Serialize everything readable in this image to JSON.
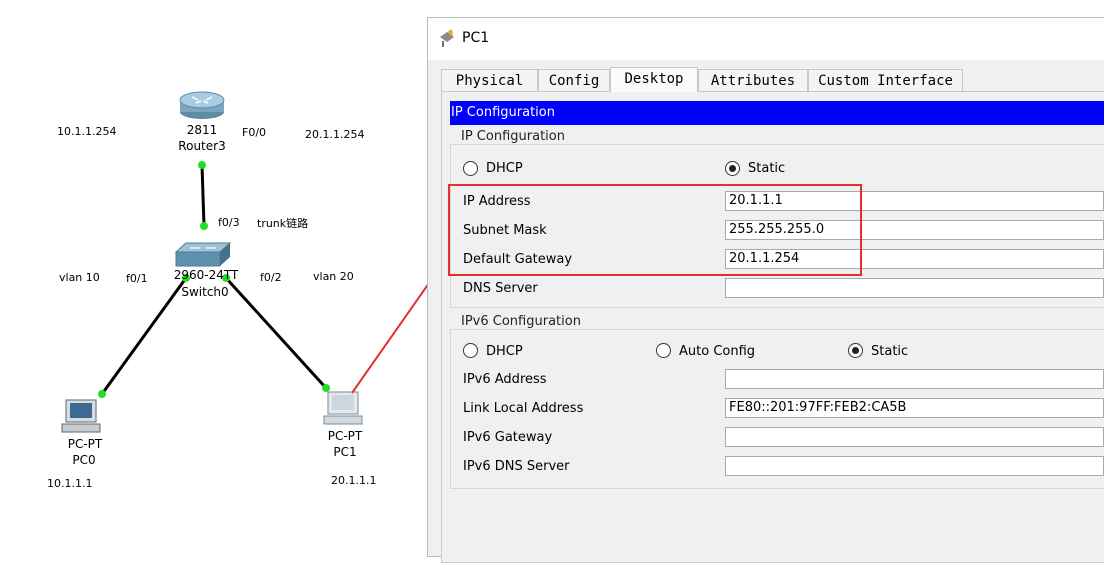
{
  "topology": {
    "router": {
      "model": "2811",
      "name": "Router3"
    },
    "switch": {
      "model": "2960-24TT",
      "name": "Switch0"
    },
    "pc0": {
      "model": "PC-PT",
      "name": "PC0",
      "ip": "10.1.1.1"
    },
    "pc1": {
      "model": "PC-PT",
      "name": "PC1",
      "ip": "20.1.1.1"
    },
    "labels": {
      "left_gw": "10.1.1.254",
      "router_port": "F0/0",
      "right_gw": "20.1.1.254",
      "switch_trunk_port": "f0/3",
      "trunk": "trunk链路",
      "vlan_left": "vlan 10",
      "port_left": "f0/1",
      "port_right": "f0/2",
      "vlan_right": "vlan 20"
    },
    "colors": {
      "link": "#000000",
      "port_dot": "#22dd22",
      "annotation_arrow": "#e03030"
    }
  },
  "window": {
    "title": "PC1",
    "icon": "packet-tracer-icon",
    "tabs": [
      {
        "label": "Physical",
        "active": false
      },
      {
        "label": "Config",
        "active": false
      },
      {
        "label": "Desktop",
        "active": true
      },
      {
        "label": "Attributes",
        "active": false
      },
      {
        "label": "Custom Interface",
        "active": false
      }
    ],
    "header": "IP Configuration",
    "ipv4": {
      "group_title": "IP Configuration",
      "mode_options": [
        {
          "label": "DHCP",
          "selected": false
        },
        {
          "label": "Static",
          "selected": true
        }
      ],
      "fields": [
        {
          "label": "IP Address",
          "value": "20.1.1.1"
        },
        {
          "label": "Subnet Mask",
          "value": "255.255.255.0"
        },
        {
          "label": "Default Gateway",
          "value": "20.1.1.254"
        },
        {
          "label": "DNS Server",
          "value": ""
        }
      ]
    },
    "ipv6": {
      "group_title": "IPv6 Configuration",
      "mode_options": [
        {
          "label": "DHCP",
          "selected": false
        },
        {
          "label": "Auto Config",
          "selected": false
        },
        {
          "label": "Static",
          "selected": true
        }
      ],
      "fields": [
        {
          "label": "IPv6 Address",
          "value": ""
        },
        {
          "label": "Link Local Address",
          "value": "FE80::201:97FF:FEB2:CA5B"
        },
        {
          "label": "IPv6 Gateway",
          "value": ""
        },
        {
          "label": "IPv6 DNS Server",
          "value": ""
        }
      ]
    },
    "colors": {
      "header_bg": "#0000ff",
      "header_fg": "#ffffff",
      "highlight": "#e03030"
    }
  }
}
